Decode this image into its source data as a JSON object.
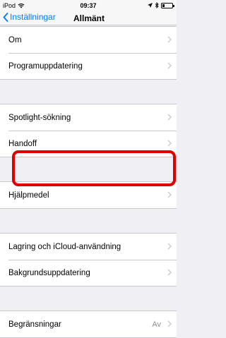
{
  "statusbar": {
    "device": "iPod",
    "time": "09:37"
  },
  "navbar": {
    "back_label": "Inställningar",
    "title": "Allmänt"
  },
  "groups": [
    {
      "items": [
        {
          "label": "Om"
        },
        {
          "label": "Programuppdatering"
        }
      ]
    },
    {
      "items": [
        {
          "label": "Spotlight-sökning"
        },
        {
          "label": "Handoff"
        }
      ]
    },
    {
      "items": [
        {
          "label": "Hjälpmedel"
        }
      ]
    },
    {
      "items": [
        {
          "label": "Lagring och iCloud-användning"
        },
        {
          "label": "Bakgrundsuppdatering"
        }
      ]
    },
    {
      "items": [
        {
          "label": "Begränsningar",
          "value": "Av"
        }
      ]
    }
  ],
  "colors": {
    "accent": "#007aff",
    "highlight": "#e00000"
  }
}
